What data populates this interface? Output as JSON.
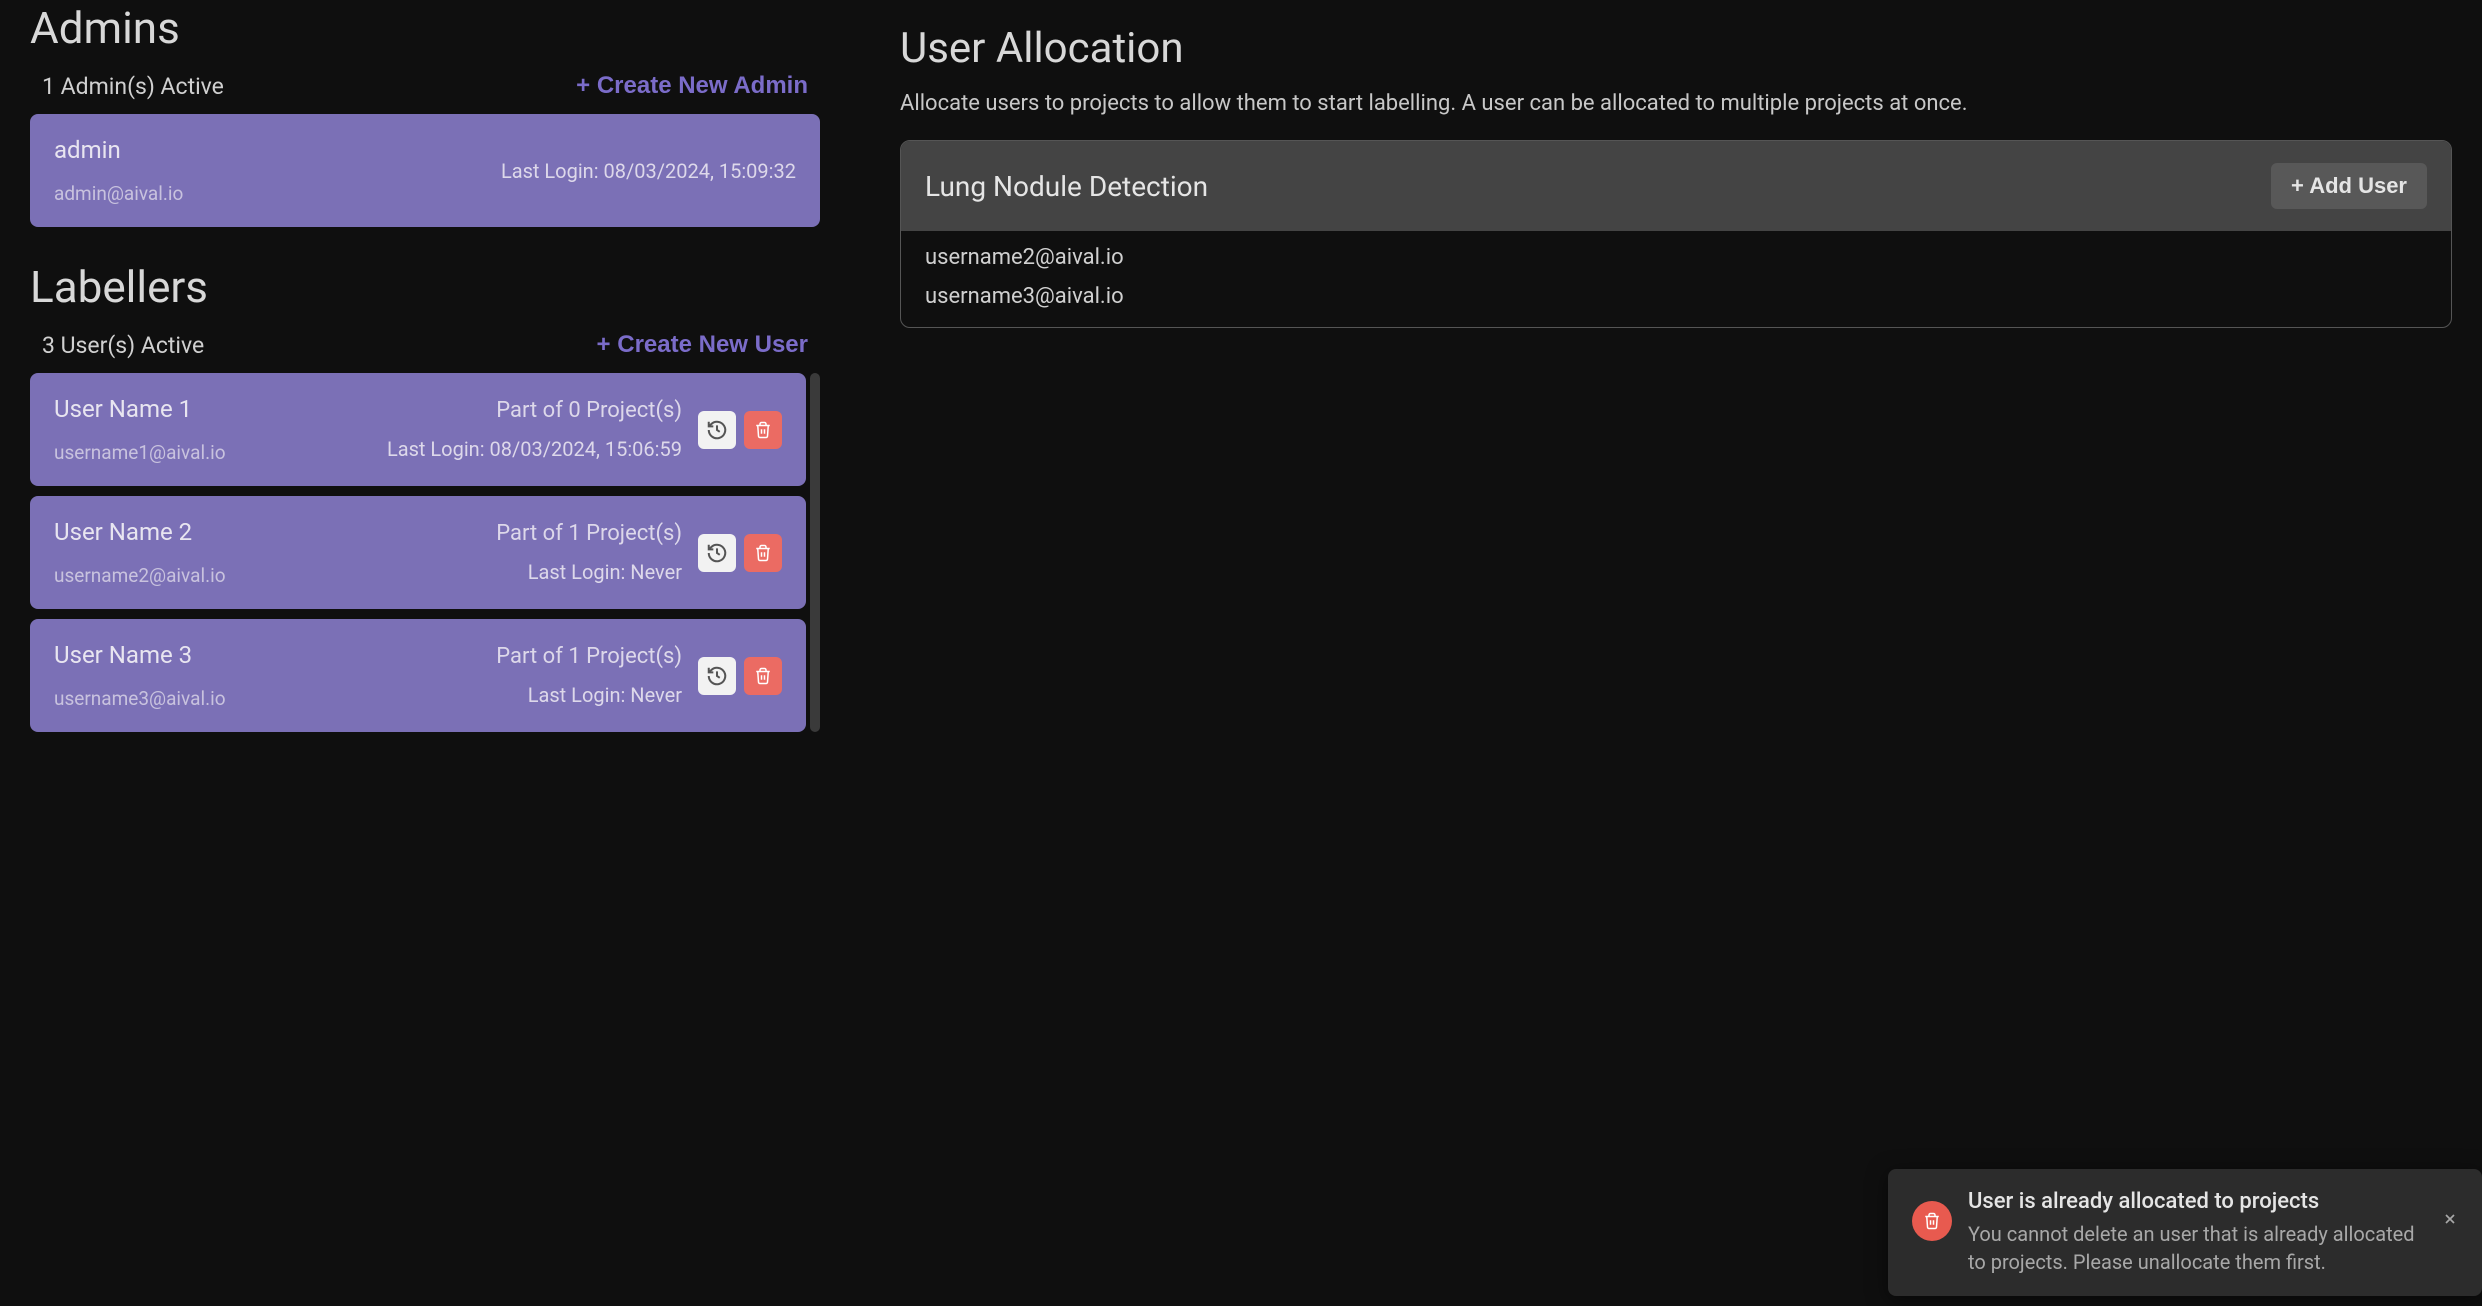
{
  "admins_section": {
    "title": "Admins",
    "active_count": "1 Admin(s) Active",
    "create_label": "+ Create New Admin",
    "items": [
      {
        "name": "admin",
        "email": "admin@aival.io",
        "last_login": "Last Login: 08/03/2024, 15:09:32"
      }
    ]
  },
  "labellers_section": {
    "title": "Labellers",
    "active_count": "3 User(s) Active",
    "create_label": "+ Create New User",
    "items": [
      {
        "name": "User Name 1",
        "email": "username1@aival.io",
        "projects": "Part of 0 Project(s)",
        "last_login": "Last Login: 08/03/2024, 15:06:59"
      },
      {
        "name": "User Name 2",
        "email": "username2@aival.io",
        "projects": "Part of 1 Project(s)",
        "last_login": "Last Login: Never"
      },
      {
        "name": "User Name 3",
        "email": "username3@aival.io",
        "projects": "Part of 1 Project(s)",
        "last_login": "Last Login: Never"
      }
    ]
  },
  "allocation_section": {
    "title": "User Allocation",
    "description": "Allocate users to projects to allow them to start labelling. A user can be allocated to multiple projects at once.",
    "projects": [
      {
        "name": "Lung Nodule Detection",
        "add_user_label": "+ Add User",
        "users": [
          "username2@aival.io",
          "username3@aival.io"
        ]
      }
    ]
  },
  "toast": {
    "title": "User is already allocated to projects",
    "message": "You cannot delete an user that is already allocated to projects. Please unallocate them first."
  }
}
